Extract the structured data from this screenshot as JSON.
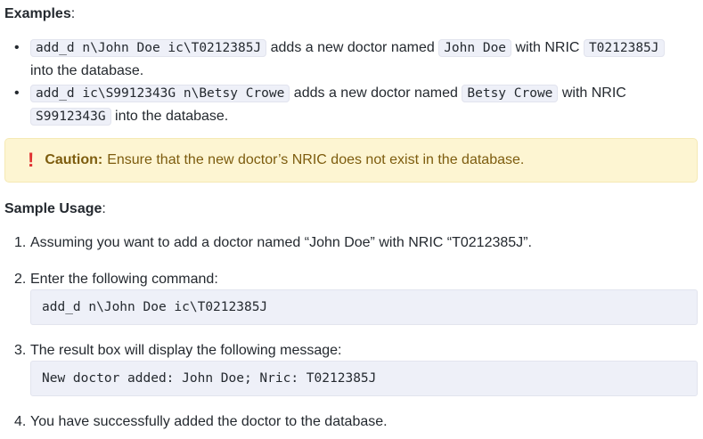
{
  "examples": {
    "heading": "Examples",
    "heading_suffix": ":",
    "items": [
      {
        "command": "add_d n\\John Doe ic\\T0212385J",
        "text_a": " adds a new doctor named ",
        "name": "John Doe",
        "text_b": " with NRIC ",
        "nric": "T0212385J",
        "text_c": " into the database."
      },
      {
        "command": "add_d ic\\S9912343G n\\Betsy Crowe",
        "text_a": " adds a new doctor named ",
        "name": "Betsy Crowe",
        "text_b": " with NRIC ",
        "nric": "S9912343G",
        "text_c": " into the database."
      }
    ]
  },
  "caution": {
    "icon": "!",
    "label": "Caution:",
    "text": "Ensure that the new doctor’s NRIC does not exist in the database."
  },
  "usage": {
    "heading": "Sample Usage",
    "heading_suffix": ":",
    "steps": [
      {
        "num": "1.",
        "text": "Assuming you want to add a doctor named “John Doe” with NRIC “T0212385J”."
      },
      {
        "num": "2.",
        "text": "Enter the following command:"
      },
      {
        "num": "3.",
        "text": "The result box will display the following message:"
      },
      {
        "num": "4.",
        "text": "You have successfully added the doctor to the database."
      }
    ],
    "command_block": "add_d n\\John Doe ic\\T0212385J",
    "result_block": "New doctor added: John Doe; Nric: T0212385J"
  },
  "colors": {
    "caution_bg": "#fdf5d2",
    "caution_text": "#7d5c0e",
    "caution_icon": "#e03131",
    "code_bg": "#eef0f8"
  }
}
